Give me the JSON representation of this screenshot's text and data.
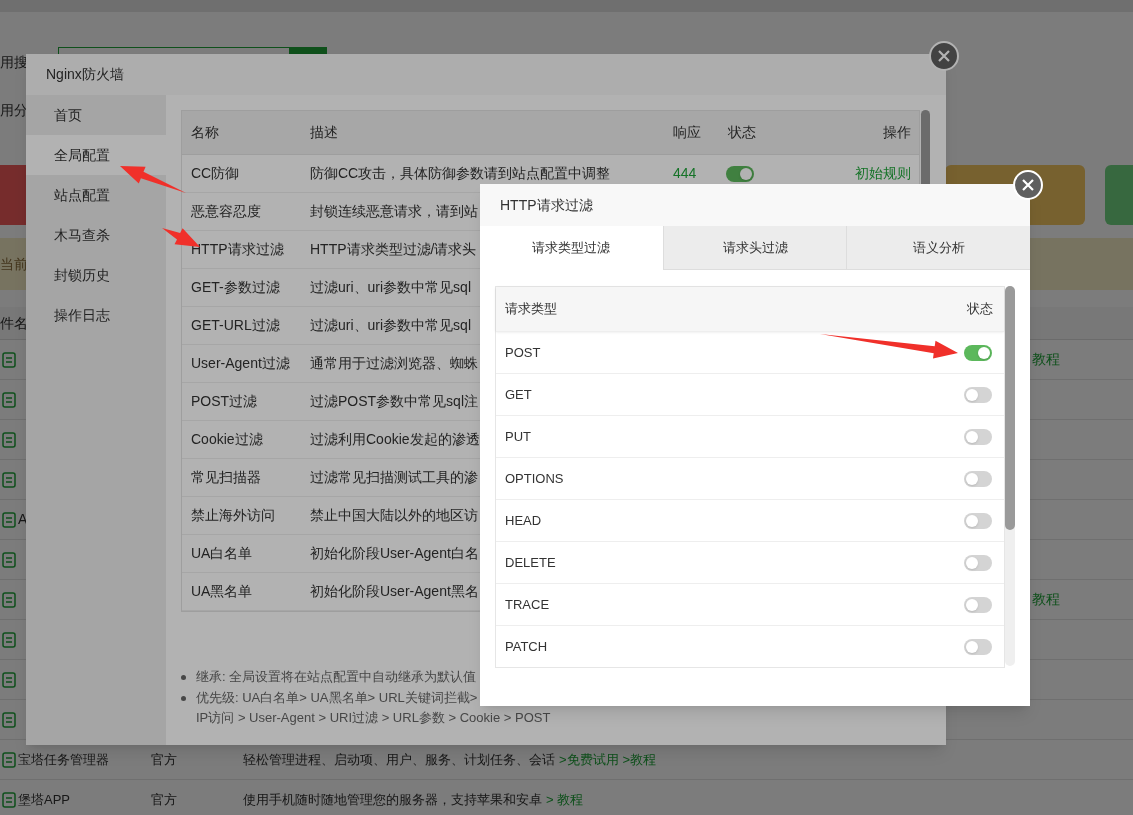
{
  "page": {
    "search_label": "用搜",
    "category_label": "用分",
    "notice": "当前",
    "table_header": "件名",
    "rows": [
      {
        "kind": "plugin",
        "link": "教程"
      },
      {
        "kind": "plugin"
      },
      {
        "kind": "plugin"
      },
      {
        "kind": "plugin"
      },
      {
        "kind": "plugin",
        "name": "A"
      },
      {
        "kind": "plugin"
      },
      {
        "kind": "plugin",
        "link": "教程"
      },
      {
        "kind": "plugin"
      },
      {
        "kind": "plugin"
      },
      {
        "kind": "plugin"
      }
    ],
    "full_rows": [
      {
        "name": "宝塔任务管理器",
        "type": "官方",
        "desc": "轻松管理进程、启动项、用户、服务、计划任务、会话",
        "links": [
          ">免费试用",
          ">教程"
        ]
      },
      {
        "name": "堡塔APP",
        "type": "官方",
        "desc": "使用手机随时随地管理您的服务器，支持苹果和安卓",
        "links": [
          "> 教程"
        ]
      }
    ]
  },
  "firewall_dialog": {
    "title": "Nginx防火墙",
    "sidebar": [
      {
        "label": "首页",
        "selected": false
      },
      {
        "label": "全局配置",
        "selected": true
      },
      {
        "label": "站点配置",
        "selected": false
      },
      {
        "label": "木马查杀",
        "selected": false
      },
      {
        "label": "封锁历史",
        "selected": false
      },
      {
        "label": "操作日志",
        "selected": false
      }
    ],
    "table": {
      "columns": [
        "名称",
        "描述",
        "响应",
        "状态",
        "操作"
      ],
      "rows": [
        {
          "name": "CC防御",
          "desc": "防御CC攻击，具体防御参数请到站点配置中调整",
          "response": "444",
          "on": true,
          "action": "初始规则"
        },
        {
          "name": "恶意容忍度",
          "desc": "封锁连续恶意请求，请到站"
        },
        {
          "name": "HTTP请求过滤",
          "desc": "HTTP请求类型过滤/请求头"
        },
        {
          "name": "GET-参数过滤",
          "desc": "过滤uri、uri参数中常见sql"
        },
        {
          "name": "GET-URL过滤",
          "desc": "过滤uri、uri参数中常见sql"
        },
        {
          "name": "User-Agent过滤",
          "desc": "通常用于过滤浏览器、蜘蛛"
        },
        {
          "name": "POST过滤",
          "desc": "过滤POST参数中常见sql注"
        },
        {
          "name": "Cookie过滤",
          "desc": "过滤利用Cookie发起的渗透"
        },
        {
          "name": "常见扫描器",
          "desc": "过滤常见扫描测试工具的渗"
        },
        {
          "name": "禁止海外访问",
          "desc": "禁止中国大陆以外的地区访"
        },
        {
          "name": "UA白名单",
          "desc": "初始化阶段User-Agent白名"
        },
        {
          "name": "UA黑名单",
          "desc": "初始化阶段User-Agent黑名"
        }
      ]
    },
    "notes": [
      [
        "继承: 全局设置将在站点配置中自动继承为默认值"
      ],
      [
        "优先级: UA白名单> UA黑名单> URL关键词拦截>",
        "IP访问 > User-Agent > URI过滤 > URL参数 > Cookie > POST"
      ]
    ]
  },
  "http_filter_dialog": {
    "title": "HTTP请求过滤",
    "tabs": [
      {
        "label": "请求类型过滤",
        "selected": true
      },
      {
        "label": "请求头过滤",
        "selected": false
      },
      {
        "label": "语义分析",
        "selected": false
      }
    ],
    "table": {
      "columns": [
        "请求类型",
        "状态"
      ],
      "rows": [
        {
          "method": "POST",
          "on": true
        },
        {
          "method": "GET",
          "on": false
        },
        {
          "method": "PUT",
          "on": false
        },
        {
          "method": "OPTIONS",
          "on": false
        },
        {
          "method": "HEAD",
          "on": false
        },
        {
          "method": "DELETE",
          "on": false
        },
        {
          "method": "TRACE",
          "on": false
        },
        {
          "method": "PATCH",
          "on": false
        }
      ]
    }
  }
}
